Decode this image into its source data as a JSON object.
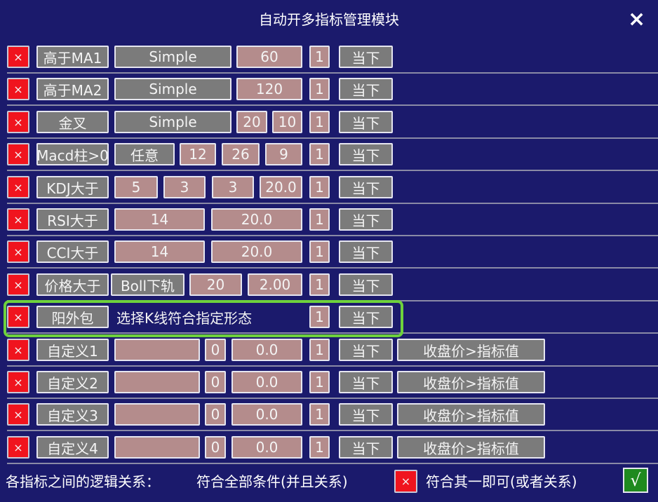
{
  "title": "自动开多指标管理模块",
  "close_icon": "×",
  "remove_icon": "×",
  "rows": [
    {
      "cells": [
        "高于MA1",
        "Simple",
        "60",
        "1",
        "当下"
      ]
    },
    {
      "cells": [
        "高于MA2",
        "Simple",
        "120",
        "1",
        "当下"
      ]
    },
    {
      "cells": [
        "金叉",
        "Simple",
        "20",
        "10",
        "1",
        "当下"
      ]
    },
    {
      "cells": [
        "Macd柱>0",
        "任意",
        "12",
        "26",
        "9",
        "1",
        "当下"
      ]
    },
    {
      "cells": [
        "KDJ大于",
        "5",
        "3",
        "3",
        "20.0",
        "1",
        "当下"
      ]
    },
    {
      "cells": [
        "RSI大于",
        "14",
        "20.0",
        "1",
        "当下"
      ]
    },
    {
      "cells": [
        "CCI大于",
        "14",
        "20.0",
        "1",
        "当下"
      ]
    },
    {
      "cells": [
        "价格大于",
        "Boll下轨",
        "20",
        "2.00",
        "1",
        "当下"
      ]
    },
    {
      "cells": [
        "阳外包",
        "选择K线符合指定形态",
        "1",
        "当下"
      ]
    },
    {
      "cells": [
        "自定义1",
        "",
        "0",
        "0.0",
        "1",
        "当下",
        "收盘价>指标值"
      ]
    },
    {
      "cells": [
        "自定义2",
        "",
        "0",
        "0.0",
        "1",
        "当下",
        "收盘价>指标值"
      ]
    },
    {
      "cells": [
        "自定义3",
        "",
        "0",
        "0.0",
        "1",
        "当下",
        "收盘价>指标值"
      ]
    },
    {
      "cells": [
        "自定义4",
        "",
        "0",
        "0.0",
        "1",
        "当下",
        "收盘价>指标值"
      ]
    }
  ],
  "footer": {
    "label": "各指标之间的逻辑关系：",
    "and_option": "符合全部条件(并且关系)",
    "and_state": "×",
    "or_option": "符合其一即可(或者关系)",
    "or_state": "√"
  },
  "colors": {
    "background": "#1b1a6c",
    "remove": "#f0141e",
    "button": "#7b7b7b",
    "value": "#b48c8c",
    "highlight": "#6ed23c",
    "checked": "#1f8a1f"
  }
}
